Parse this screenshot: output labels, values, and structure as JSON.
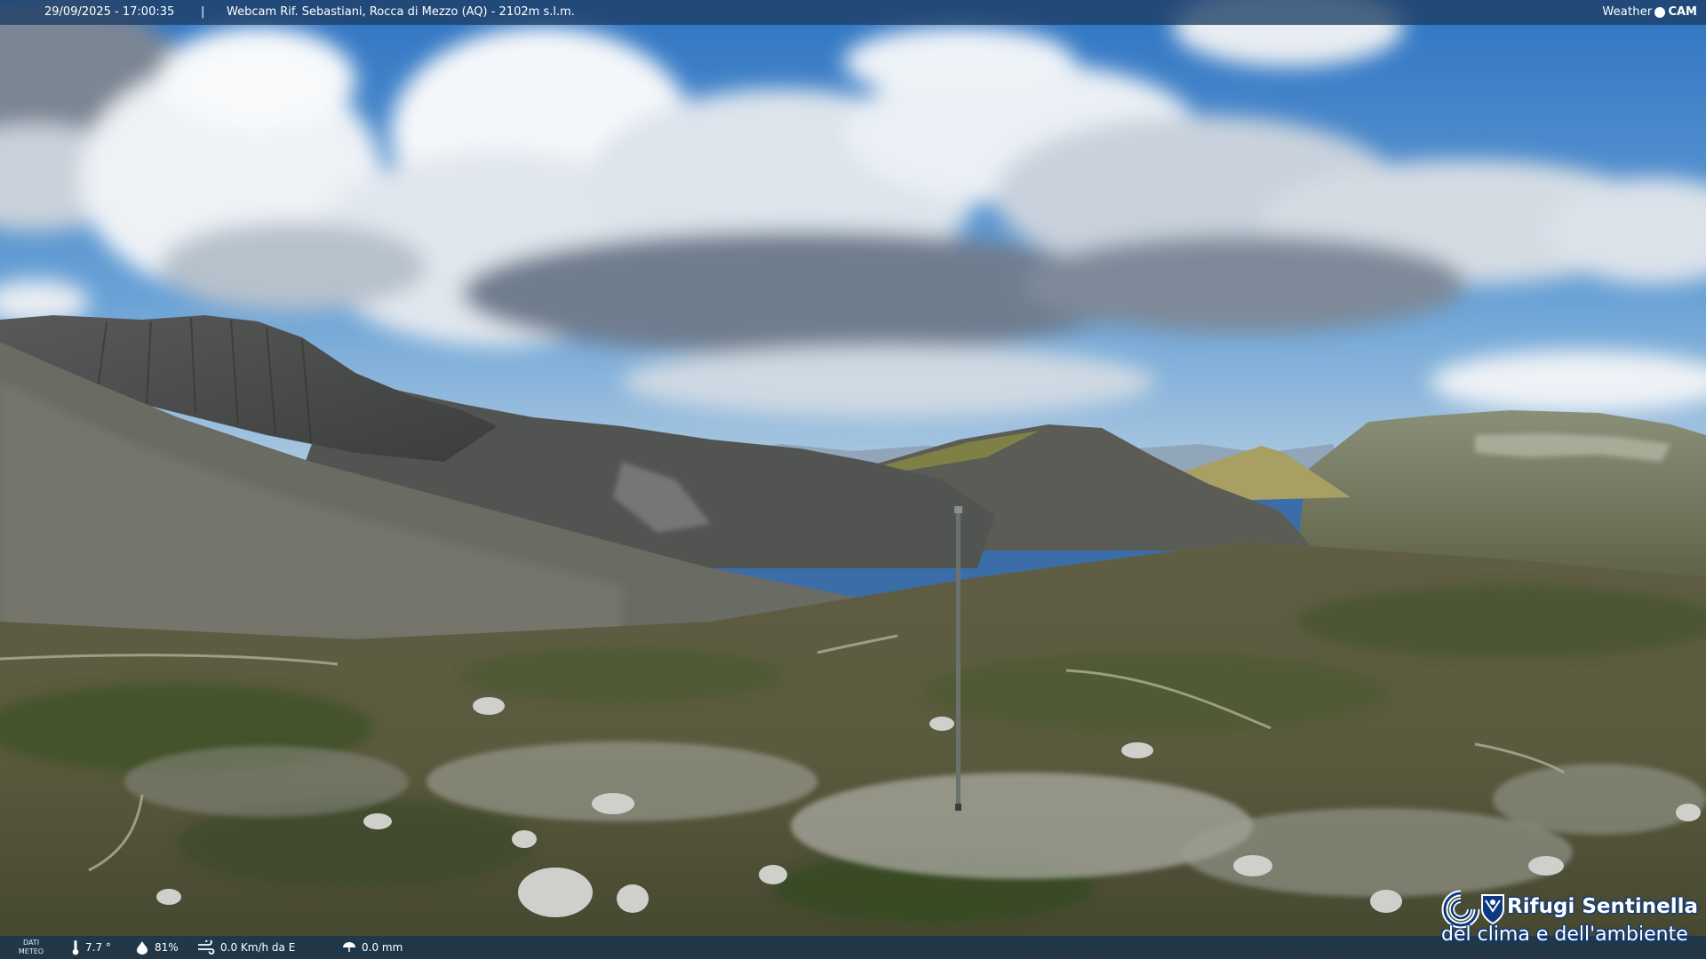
{
  "header": {
    "datetime": "29/09/2025 - 17:00:35",
    "separator": "|",
    "caption": "Webcam Rif. Sebastiani, Rocca di Mezzo (AQ) - 2102m s.l.m.",
    "logo_left": "Weather",
    "logo_right": "CAM"
  },
  "weather": {
    "label_line1": "DATI",
    "label_line2": "METEO",
    "temperature": "7.7 °",
    "humidity": "81%",
    "wind": "0.0 Km/h da E",
    "rain": "0.0 mm",
    "icons": [
      "thermometer-icon",
      "humidity-drop-icon",
      "wind-icon",
      "rain-icon"
    ]
  },
  "branding": {
    "line1": "Rifugi Sentinella",
    "line2": "del clima e dell'ambiente",
    "emblem": "cai-shield-emblem"
  },
  "colors": {
    "sky_top": "#3b7cc4",
    "sky_horizon": "#a9c8e2",
    "cloud": "#f2f5f8",
    "cloud_shadow": "#6e7f93",
    "mountain_dark": "#4a4b4a",
    "grass": "#6b6a3f",
    "bar_bg": "#1e3e64",
    "brand_blue": "#0b3a82"
  }
}
